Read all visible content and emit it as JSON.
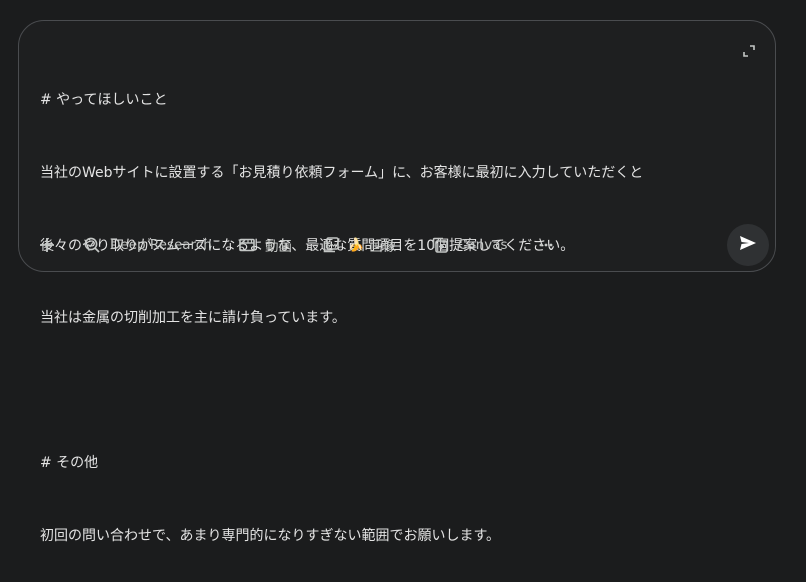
{
  "prompt": {
    "lines": [
      "# やってほしいこと",
      "当社のWebサイトに設置する「お見積り依頼フォーム」に、お客様に最初に入力していただくと",
      "後々のやり取りがスムーズになるような、最適な質問項目を10個提案してください。",
      "当社は金属の切削加工を主に請け負っています。",
      "",
      "# その他",
      "初回の問い合わせで、あまり専門的になりすぎない範囲でお願いします。"
    ]
  },
  "toolbar": {
    "add_icon": "plus-icon",
    "deep_research_label": "Deep Research",
    "deep_research_icon": "deep-research-icon",
    "video_label": "動画",
    "video_icon": "film-icon",
    "image_label": "画像",
    "image_icon": "image-stack-icon",
    "image_emoji": "🍌",
    "canvas_label": "Canvas",
    "canvas_icon": "canvas-icon",
    "more_icon": "more-horizontal-icon"
  },
  "colors": {
    "background": "#1b1c1d",
    "surface": "#1e1f20",
    "border": "#4a4c4f",
    "text": "#e3e3e3",
    "muted_text": "#c4c7c5",
    "send_button": "#2f3133"
  }
}
